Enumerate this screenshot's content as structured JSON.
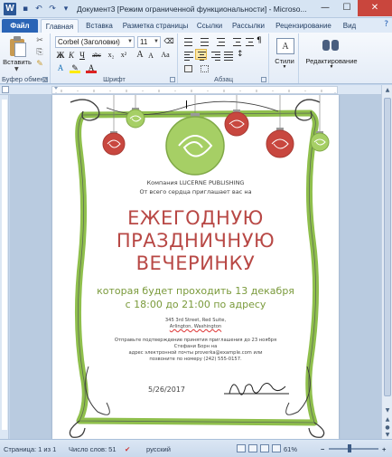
{
  "app": {
    "icon_letter": "W",
    "title": "Документ3 [Режим ограниченной функциональности] - Microso..."
  },
  "window_buttons": {
    "minimize": "—",
    "maximize": "☐",
    "close": "✕"
  },
  "tabs": [
    {
      "label": "Файл"
    },
    {
      "label": "Главная"
    },
    {
      "label": "Вставка"
    },
    {
      "label": "Разметка страницы"
    },
    {
      "label": "Ссылки"
    },
    {
      "label": "Рассылки"
    },
    {
      "label": "Рецензирование"
    },
    {
      "label": "Вид"
    }
  ],
  "ribbon": {
    "clipboard": {
      "paste_label": "Вставить",
      "group_label": "Буфер обмена"
    },
    "font": {
      "font_name": "Corbel (Заголовки)",
      "font_size": "11",
      "bold": "Ж",
      "italic": "К",
      "underline": "Ч",
      "strike": "abc",
      "sub": "x₂",
      "sup": "x²",
      "grow": "A",
      "shrink": "A",
      "case": "Aa",
      "group_label": "Шрифт"
    },
    "paragraph": {
      "group_label": "Абзац"
    },
    "styles": {
      "label": "Стили"
    },
    "editing": {
      "label": "Редактирование"
    }
  },
  "document": {
    "company_line": "Компания LUCERNE PUBLISHING",
    "invite_line": "От всего сердца приглашает вас на",
    "headline": [
      "ЕЖЕГОДНУЮ",
      "ПРАЗДНИЧНУЮ",
      "ВЕЧЕРИНКУ"
    ],
    "subline": [
      "которая будет проходить 13 декабря",
      "с 18:00 до 21:00 по адресу"
    ],
    "address": [
      "345 3rd Street, Red Suite,",
      "Arlington, Washington"
    ],
    "rsvp": [
      "Отправьте подтверждение принятия приглашения до 23 ноября",
      "Стефани Борн на",
      "адрес электронной почты proverka@example.com или",
      "позвоните по номеру (242) 555-0157."
    ],
    "date": "5/26/2017"
  },
  "status": {
    "page": "Страница: 1 из 1",
    "words": "Число слов: 51",
    "language": "русский",
    "zoom": "61%",
    "zoom_minus": "−",
    "zoom_plus": "+"
  },
  "colors": {
    "headline": "#b84845",
    "subline": "#7a9a3b",
    "ornament_green": "#8fbf4c",
    "ornament_red": "#c8473f",
    "file_tab": "#2a64b6"
  }
}
